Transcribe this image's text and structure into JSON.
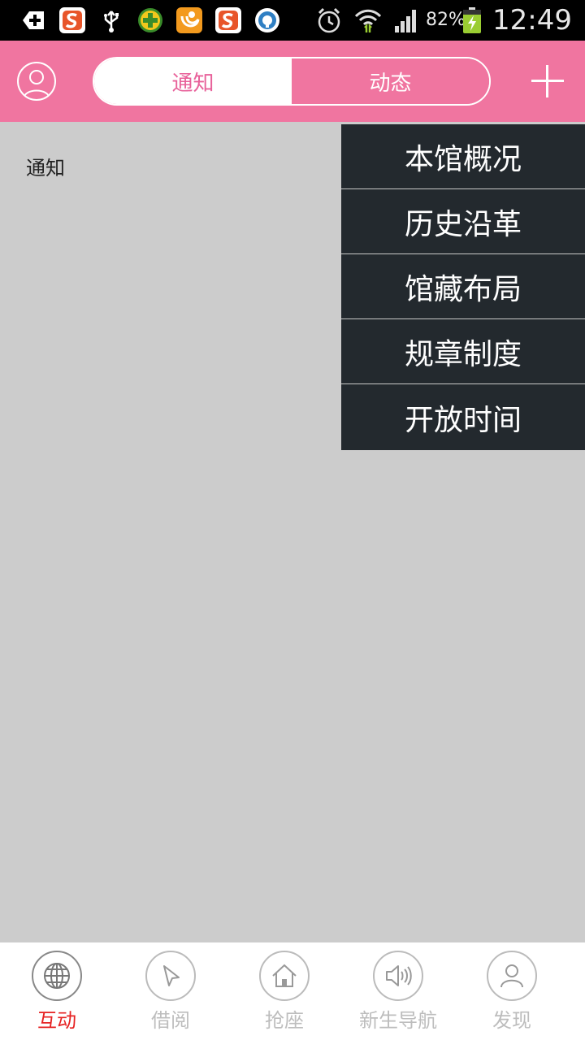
{
  "status_bar": {
    "battery_percent": "82%",
    "time": "12:49",
    "icons": [
      "add-box-icon",
      "sogou-icon",
      "usb-icon",
      "game-icon",
      "uc-browser-icon",
      "sogou-icon",
      "vpn-icon",
      "alarm-icon",
      "wifi-icon",
      "signal-icon",
      "battery-charging-icon"
    ]
  },
  "header": {
    "tabs": [
      {
        "label": "通知",
        "active": true
      },
      {
        "label": "动态",
        "active": false
      }
    ]
  },
  "content": {
    "label": "通知"
  },
  "dropdown": {
    "items": [
      "本馆概况",
      "历史沿革",
      "馆藏布局",
      "规章制度",
      "开放时间"
    ]
  },
  "bottom_nav": {
    "items": [
      {
        "label": "互动",
        "icon": "globe-icon",
        "active": true
      },
      {
        "label": "借阅",
        "icon": "cursor-icon",
        "active": false
      },
      {
        "label": "抢座",
        "icon": "home-icon",
        "active": false
      },
      {
        "label": "新生导航",
        "icon": "speaker-icon",
        "active": false
      },
      {
        "label": "发现",
        "icon": "person-icon",
        "active": false
      }
    ]
  },
  "colors": {
    "header_pink": "#f075a0",
    "active_tab_text": "#e8619a",
    "dropdown_bg": "#23292e",
    "content_bg": "#cccccc",
    "nav_active": "#e62222",
    "nav_inactive": "#bdbdbd"
  }
}
